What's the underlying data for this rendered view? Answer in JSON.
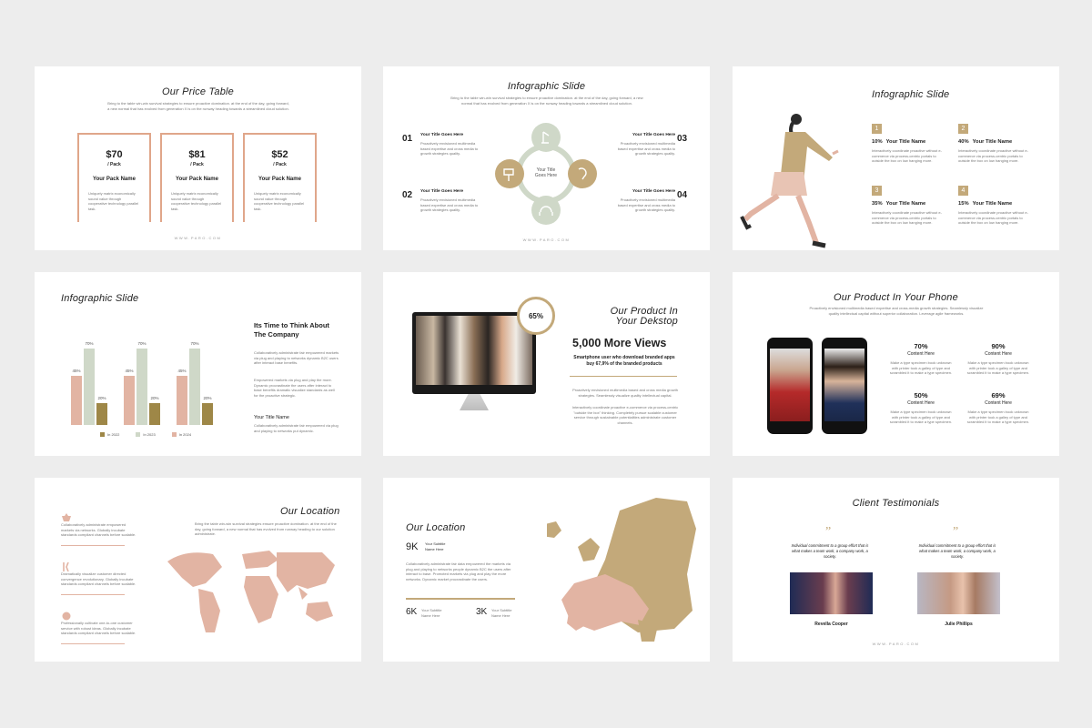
{
  "colors": {
    "beige": "#c3a97a",
    "peach": "#e2b4a3",
    "sage": "#cfd8c8",
    "olive": "#9e8747",
    "orange": "#e0a68a"
  },
  "s1": {
    "title": "Our Price Table",
    "desc": "Bring to the table win-win survival strategies to ensure proactive domination. at the end of the day, going forward, a new normal that has evolved from generation X is on the runway heading towards a streamlined cloud solution.",
    "cards": [
      {
        "price": "$70",
        "per": "/ Pack",
        "name": "Your Pack Name",
        "desc": "Uniquely matrix economically sound value through cooperative technology parallel task."
      },
      {
        "price": "$81",
        "per": "/ Pack",
        "name": "Your Pack Name",
        "desc": "Uniquely matrix economically sound value through cooperative technology parallel task."
      },
      {
        "price": "$52",
        "per": "/ Pack",
        "name": "Your Pack Name",
        "desc": "Uniquely matrix economically sound value through cooperative technology parallel task."
      }
    ],
    "footer": "WWW.PARO.COM"
  },
  "s2": {
    "title": "Infographic Slide",
    "desc": "Bring to the table win-win survival strategies to ensure proactive domination. at the end of the day, going forward, a new normal that has evolved from generation X is on the runway heading towards a streamlined cloud solution.",
    "center": "Your Title Goes Here",
    "items": [
      {
        "num": "01",
        "title": "Your Title Goes Here",
        "desc": "Proactively envisioned multimedia based expertise and cross media to growth strategies quality."
      },
      {
        "num": "02",
        "title": "Your Title Goes Here",
        "desc": "Proactively envisioned multimedia based expertise and cross media to growth strategies quality."
      },
      {
        "num": "03",
        "title": "Your Title Goes Here",
        "desc": "Proactively envisioned multimedia based expertise and cross media to growth strategies quality."
      },
      {
        "num": "04",
        "title": "Your Title Goes Here",
        "desc": "Proactively envisioned multimedia based expertise and cross media to growth strategies quality."
      }
    ],
    "footer": "WWW.PARO.COM"
  },
  "s3": {
    "title": "Infographic Slide",
    "items": [
      {
        "n": "1",
        "pct": "10%",
        "title": "Your Title Name",
        "desc": "Interactively coordinate proactive without e-commerce via process-centric portals to outside the box on low hanging more."
      },
      {
        "n": "2",
        "pct": "40%",
        "title": "Your Title Name",
        "desc": "Interactively coordinate proactive without e-commerce via process-centric portals to outside the box on low hanging more."
      },
      {
        "n": "3",
        "pct": "35%",
        "title": "Your Title Name",
        "desc": "Interactively coordinate proactive without e-commerce via process-centric portals to outside the box on low hanging more."
      },
      {
        "n": "4",
        "pct": "15%",
        "title": "Your Title Name",
        "desc": "Interactively coordinate proactive without e-commerce via process-centric portals to outside the box on low hanging more."
      }
    ]
  },
  "s4": {
    "title": "Infographic Slide",
    "heading": "Its Time to Think About The Company",
    "desc1": "Collaboratively administrate fair empowered markets via plug and playing to networks dynamic B2C users after interact base benefits.",
    "desc2": "Empowered markets via plug and play the more. Dynamic procrastinate the users after interact to base benefits dramatic visualize standards as well for the proactive strategic.",
    "sub": "Your Title Name",
    "desc3": "Collaboratively administrate fair empowered via plug and playing to networks put dynamic.",
    "legend": [
      "In 2022",
      "In 2023",
      "In 2024"
    ]
  },
  "chart_data": {
    "type": "bar",
    "categories": [
      "1",
      "2",
      "3"
    ],
    "series": [
      {
        "name": "In 2022",
        "values": [
          45,
          45,
          45
        ]
      },
      {
        "name": "In 2023",
        "values": [
          70,
          70,
          70
        ]
      },
      {
        "name": "In 2024",
        "values": [
          20,
          20,
          20
        ]
      }
    ],
    "ylim": [
      0,
      75
    ]
  },
  "s4labels": [
    "45%",
    "70%",
    "20%"
  ],
  "s5": {
    "badge": "65%",
    "title": "Our Product In Your Dekstop",
    "big": "5,000 More Views",
    "sub": "Smartphone user who download branded apps buy 67,9% of the branded products",
    "desc1": "Proactively envisioned multimedia based and cross media growth strategies. Seamlessly visualize quality intellectual capital.",
    "desc2": "Interactively coordinate proactive e-commerce via process-centric \"outside the box\" thinking. Completely pursue scalable customer service through sustainable potentialities administrate customer channels."
  },
  "s6": {
    "title": "Our Product In Your Phone",
    "desc": "Proactively envisioned multimedia based expertise and cross-media growth strategies. Seamlessly visualize quality intellectual capital without superior collaboration. Leverage agile frameworks.",
    "items": [
      {
        "pct": "70%",
        "label": "Content Here",
        "desc": "Make a type specimen book unknown with printer took a galley of type and scrambled it to make a type specimen."
      },
      {
        "pct": "90%",
        "label": "Content Here",
        "desc": "Make a type specimen book unknown with printer took a galley of type and scrambled it to make a type specimen."
      },
      {
        "pct": "50%",
        "label": "Content Here",
        "desc": "Make a type specimen book unknown with printer took a galley of type and scrambled it to make a type specimen."
      },
      {
        "pct": "69%",
        "label": "Content Here",
        "desc": "Make a type specimen book unknown with printer took a galley of type and scrambled it to make a type specimen."
      }
    ]
  },
  "s7": {
    "title": "Our Location",
    "desc": "Bring the table win-win survival strategies ensure proactive domination. at the end of the day, going forward, a new normal that has evolved from runway heading to our solution administrate.",
    "items": [
      "Collaboratively administrate empowered markets via networks. Globally incubate standards compliant channels before scalable.",
      "Dramatically visualize customer directed convergence revolutionary. Globally incubate standards compliant channels before scalable.",
      "Professionally cultivate one-to-one customer service with robust ideas. Globally incubate standards compliant channels before scalable."
    ]
  },
  "s8": {
    "title": "Our Location",
    "k1": "9K",
    "k1label": "Your Subtitle Name Here",
    "desc": "Collaboratively administrate fair data empowered the markets via plug and playing to networks people dynamic B2C the users after interact to base. Promoted markets via plug and play the more networks. Dynamic market procrastinate the users.",
    "k2": "6K",
    "k2label": "Your Subtitle Name Here",
    "k3": "3K",
    "k3label": "Your Subtitle Name Here"
  },
  "s9": {
    "title": "Client Testimonials",
    "quotes": [
      {
        "text": "Individual commitment to a group effort that is what makes a team work, a company work, a society.",
        "name": "Revella Cooper"
      },
      {
        "text": "Individual commitment to a group effort that is what makes a team work, a company work, a society.",
        "name": "Julie Phillips"
      }
    ],
    "footer": "WWW.PARO.COM"
  }
}
